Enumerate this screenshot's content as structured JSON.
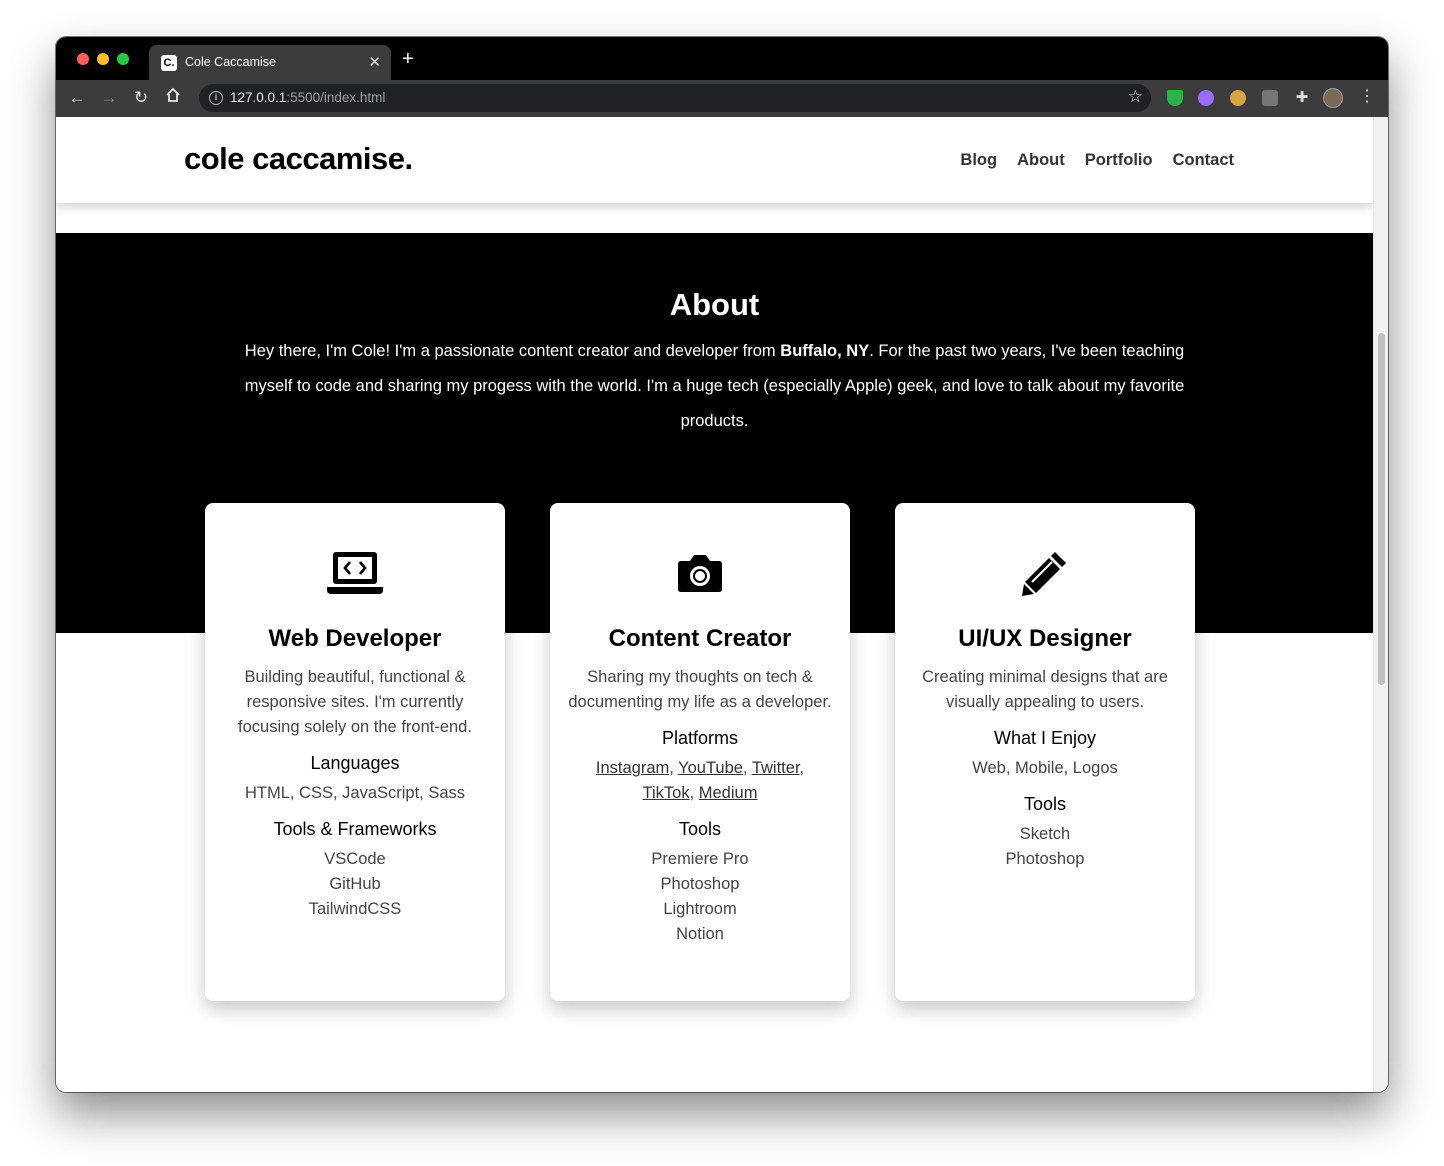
{
  "browser": {
    "tab_title": "Cole Caccamise",
    "favicon_text": "C.",
    "url_host": "127.0.0.1",
    "url_rest": ":5500/index.html"
  },
  "site": {
    "logo": "cole caccamise.",
    "nav": [
      "Blog",
      "About",
      "Portfolio",
      "Contact"
    ]
  },
  "about": {
    "title": "About",
    "intro_before": "Hey there, I'm Cole! I'm a passionate content creator and developer from ",
    "intro_bold": "Buffalo, NY",
    "intro_after": ". For the past two years, I've been teaching myself to code and sharing my progess with the world. I'm a huge tech (especially Apple) geek, and love to talk about my favorite products."
  },
  "cards": [
    {
      "icon": "laptop-code-icon",
      "title": "Web Developer",
      "description": "Building beautiful, functional & responsive sites. I'm currently focusing solely on the front-end.",
      "section1_title": "Languages",
      "section1_value": "HTML, CSS, JavaScript, Sass",
      "section2_title": "Tools & Frameworks",
      "section2_items": [
        "VSCode",
        "GitHub",
        "TailwindCSS"
      ]
    },
    {
      "icon": "camera-icon",
      "title": "Content Creator",
      "description": "Sharing my thoughts on tech & documenting my life as a developer.",
      "section1_title": "Platforms",
      "platforms": [
        "Instagram",
        "YouTube",
        "Twitter",
        "TikTok",
        "Medium"
      ],
      "section2_title": "Tools",
      "section2_items": [
        "Premiere Pro",
        "Photoshop",
        "Lightroom",
        "Notion"
      ]
    },
    {
      "icon": "pencil-icon",
      "title": "UI/UX Designer",
      "description": "Creating minimal designs that are visually appealing to users.",
      "section1_title": "What I Enjoy",
      "section1_value": "Web, Mobile, Logos",
      "section2_title": "Tools",
      "section2_items": [
        "Sketch",
        "Photoshop"
      ]
    }
  ]
}
